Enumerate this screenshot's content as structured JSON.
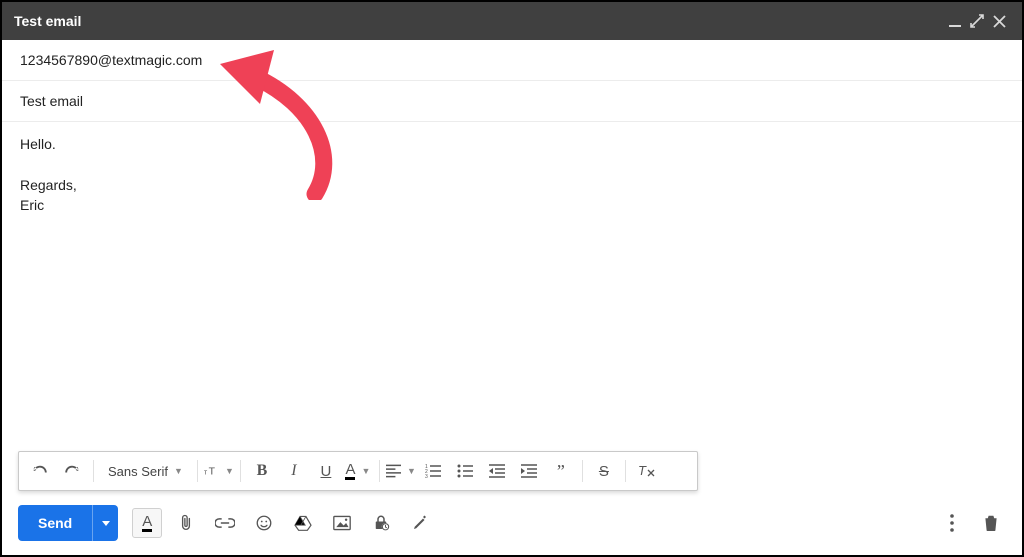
{
  "window": {
    "title": "Test email"
  },
  "recipient": "1234567890@textmagic.com",
  "subject": "Test email",
  "body": {
    "line1": "Hello.",
    "line2": "Regards,",
    "line3": "Eric"
  },
  "toolbar": {
    "font_family": "Sans Serif",
    "send_label": "Send"
  },
  "colors": {
    "accent": "#1a73e8",
    "arrow": "#ef4156"
  }
}
